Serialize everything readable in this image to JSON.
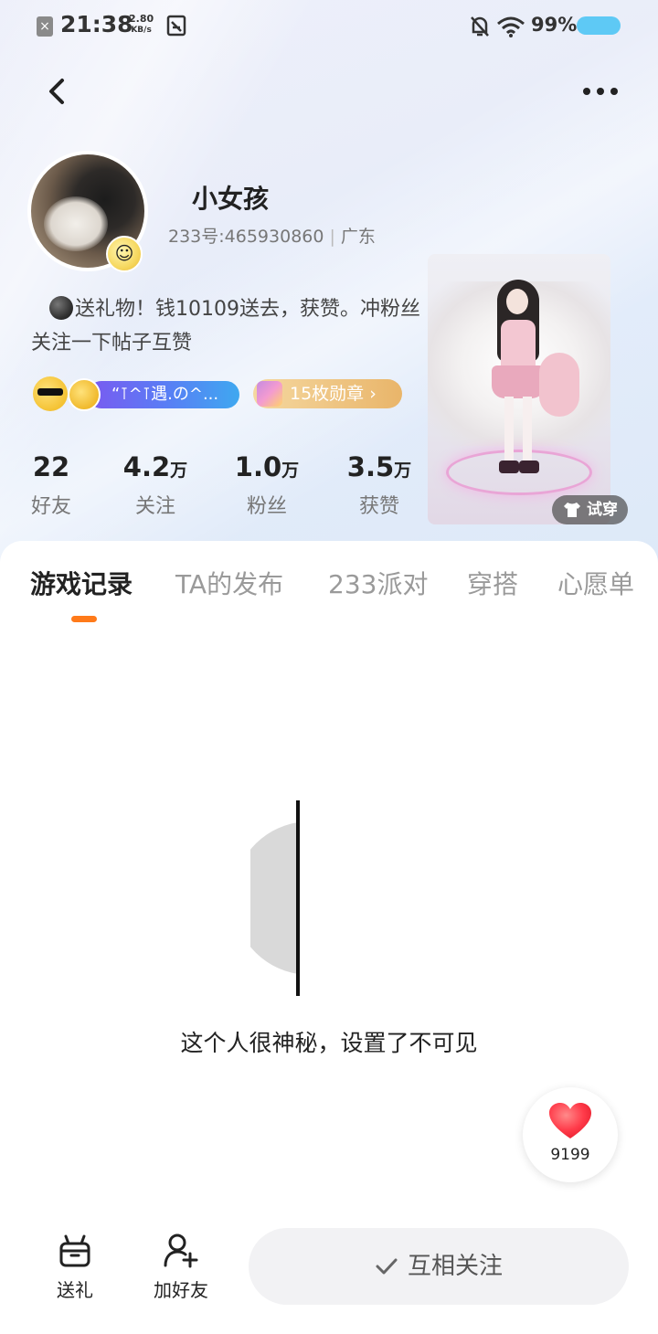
{
  "status_bar": {
    "time": "21:38",
    "net_speed_value": "2.80",
    "net_speed_unit": "KB/s",
    "battery": "99%",
    "icons": [
      "notification-x-icon",
      "sim-icon",
      "bell-off-icon",
      "wifi-icon",
      "battery-icon"
    ]
  },
  "nav": {
    "back_icon": "chevron-left-icon",
    "more_icon": "more-dots-icon"
  },
  "profile": {
    "name": "小女孩",
    "id_label": "233号:465930860",
    "region": "广东",
    "bio": "送礼物！钱10109送去，获赞。冲粉丝关注一下帖子互赞",
    "tag_text": "“⊺^⊺遇.の^...",
    "badge_text": "15枚勋章 ›"
  },
  "stats": [
    {
      "value": "22",
      "unit": "",
      "label": "好友"
    },
    {
      "value": "4.2",
      "unit": "万",
      "label": "关注"
    },
    {
      "value": "1.0",
      "unit": "万",
      "label": "粉丝"
    },
    {
      "value": "3.5",
      "unit": "万",
      "label": "获赞"
    }
  ],
  "tryon_label": "试穿",
  "tabs": [
    {
      "label": "游戏记录",
      "active": true
    },
    {
      "label": "TA的发布",
      "active": false
    },
    {
      "label": "233派对",
      "active": false
    },
    {
      "label": "穿搭",
      "active": false
    },
    {
      "label": "心愿单",
      "active": false
    }
  ],
  "empty_state": {
    "message": "这个人很神秘，设置了不可见"
  },
  "like": {
    "count": "9199"
  },
  "bottom_bar": {
    "gift_label": "送礼",
    "add_friend_label": "加好友",
    "follow_label": "互相关注"
  },
  "colors": {
    "accent": "#ff7a1a",
    "battery": "#5ec9f5",
    "heart": "#ff3b4a"
  }
}
